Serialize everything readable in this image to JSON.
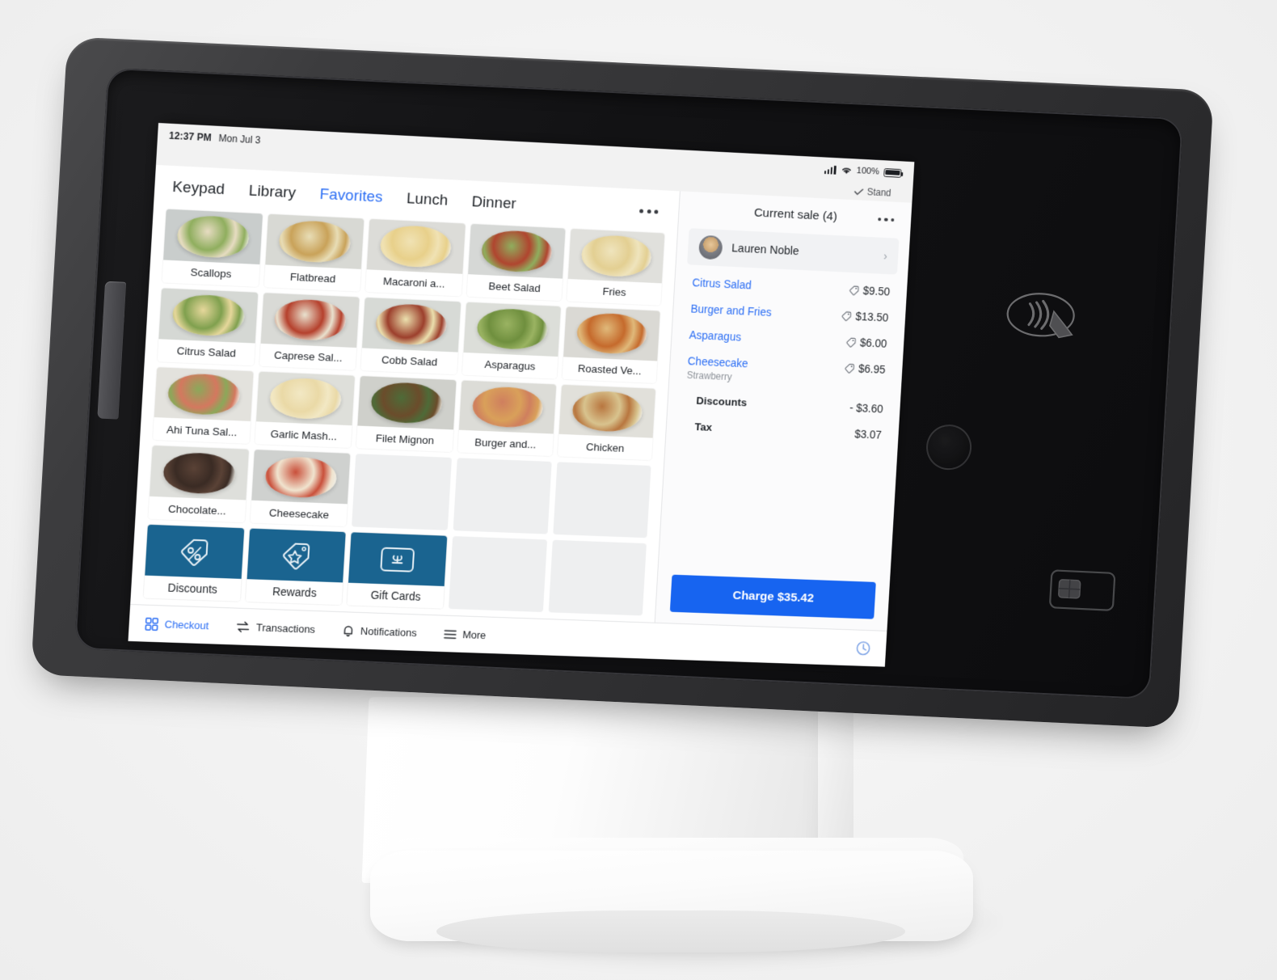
{
  "device": {
    "name": "square-register-stand",
    "contactless_icon": "contactless-payment-icon",
    "chip_icon": "chip-card-icon",
    "home_button": "home-button"
  },
  "statusbar": {
    "time": "12:37 PM",
    "date": "Mon Jul 3",
    "battery_percent": "100%",
    "stand_label": "Stand",
    "icons": [
      "cellular-signal-icon",
      "wifi-icon",
      "battery-icon",
      "check-icon"
    ]
  },
  "tabs": [
    {
      "label": "Keypad",
      "active": false
    },
    {
      "label": "Library",
      "active": false
    },
    {
      "label": "Favorites",
      "active": true
    },
    {
      "label": "Lunch",
      "active": false
    },
    {
      "label": "Dinner",
      "active": false
    }
  ],
  "grid": {
    "items": [
      {
        "label": "Scallops",
        "type": "item",
        "c1": "#8fae5e",
        "c2": "#e7dcc2",
        "plate": "#c9cdcc"
      },
      {
        "label": "Flatbread",
        "type": "item",
        "c1": "#c9a259",
        "c2": "#e8ddb6",
        "plate": "#d8d9d4"
      },
      {
        "label": "Macaroni a...",
        "type": "item",
        "c1": "#e8d08a",
        "c2": "#f0e2b4",
        "plate": "#dcdcd8"
      },
      {
        "label": "Beet Salad",
        "type": "item",
        "c1": "#b0452f",
        "c2": "#8fae5e",
        "plate": "#d6d8d6"
      },
      {
        "label": "Fries",
        "type": "item",
        "c1": "#e3cf92",
        "c2": "#efe4bd",
        "plate": "#e0e0dc"
      },
      {
        "label": "Citrus Salad",
        "type": "item",
        "c1": "#7fa04e",
        "c2": "#e6d79b",
        "plate": "#d5d8d4"
      },
      {
        "label": "Caprese Sal...",
        "type": "item",
        "c1": "#b5402c",
        "c2": "#e9e2cf",
        "plate": "#d9dad6"
      },
      {
        "label": "Cobb Salad",
        "type": "item",
        "c1": "#9c3f2c",
        "c2": "#ebe0ae",
        "plate": "#d7dad6"
      },
      {
        "label": "Asparagus",
        "type": "item",
        "c1": "#6f8f3e",
        "c2": "#9ab362",
        "plate": "#dcded9"
      },
      {
        "label": "Roasted Ve...",
        "type": "item",
        "c1": "#c56a2c",
        "c2": "#e0b97a",
        "plate": "#dad9d4"
      },
      {
        "label": "Ahi Tuna Sal...",
        "type": "item",
        "c1": "#d4785f",
        "c2": "#8ba85a",
        "plate": "#e3e2dd"
      },
      {
        "label": "Garlic Mash...",
        "type": "item",
        "c1": "#ead9a6",
        "c2": "#f2e8c4",
        "plate": "#dedfda"
      },
      {
        "label": "Filet Mignon",
        "type": "item",
        "c1": "#6b4c2b",
        "c2": "#4e6b38",
        "plate": "#cfd0cb"
      },
      {
        "label": "Burger and...",
        "type": "item",
        "c1": "#d9a05a",
        "c2": "#cf7f5e",
        "plate": "#dcdcd7"
      },
      {
        "label": "Chicken",
        "type": "item",
        "c1": "#d8c38e",
        "c2": "#b8763f",
        "plate": "#e1e0da"
      },
      {
        "label": "Chocolate...",
        "type": "item",
        "c1": "#3a2b24",
        "c2": "#5a4236",
        "plate": "#dedfdb"
      },
      {
        "label": "Cheesecake",
        "type": "item",
        "c1": "#f0e4cf",
        "c2": "#c94f3a",
        "plate": "#cfd1cf"
      },
      {
        "label": "",
        "type": "empty"
      },
      {
        "label": "",
        "type": "empty"
      },
      {
        "label": "",
        "type": "empty"
      },
      {
        "label": "Discounts",
        "type": "action",
        "icon": "discount-tag-icon"
      },
      {
        "label": "Rewards",
        "type": "action",
        "icon": "rewards-tag-icon"
      },
      {
        "label": "Gift Cards",
        "type": "action",
        "icon": "gift-card-icon"
      },
      {
        "label": "",
        "type": "empty"
      },
      {
        "label": "",
        "type": "empty"
      }
    ]
  },
  "cart": {
    "title": "Current sale (4)",
    "customer": "Lauren Noble",
    "lines": [
      {
        "name": "Citrus Salad",
        "modifier": "",
        "amount": "$9.50",
        "tag": true
      },
      {
        "name": "Burger and Fries",
        "modifier": "",
        "amount": "$13.50",
        "tag": true
      },
      {
        "name": "Asparagus",
        "modifier": "",
        "amount": "$6.00",
        "tag": true
      },
      {
        "name": "Cheesecake",
        "modifier": "Strawberry",
        "amount": "$6.95",
        "tag": true
      }
    ],
    "totals": [
      {
        "name": "Discounts",
        "amount": "- $3.60"
      },
      {
        "name": "Tax",
        "amount": "$3.07"
      }
    ],
    "charge_label": "Charge $35.42"
  },
  "bottomnav": [
    {
      "label": "Checkout",
      "icon": "grid-icon",
      "active": true
    },
    {
      "label": "Transactions",
      "icon": "transfer-arrows-icon",
      "active": false
    },
    {
      "label": "Notifications",
      "icon": "bell-icon",
      "active": false
    },
    {
      "label": "More",
      "icon": "hamburger-icon",
      "active": false
    }
  ],
  "bottomnav_clock_icon": "clock-icon",
  "colors": {
    "accent_blue": "#2a6df4",
    "charge_blue": "#1764f0",
    "action_tile": "#1a6490",
    "text": "#22262b"
  }
}
